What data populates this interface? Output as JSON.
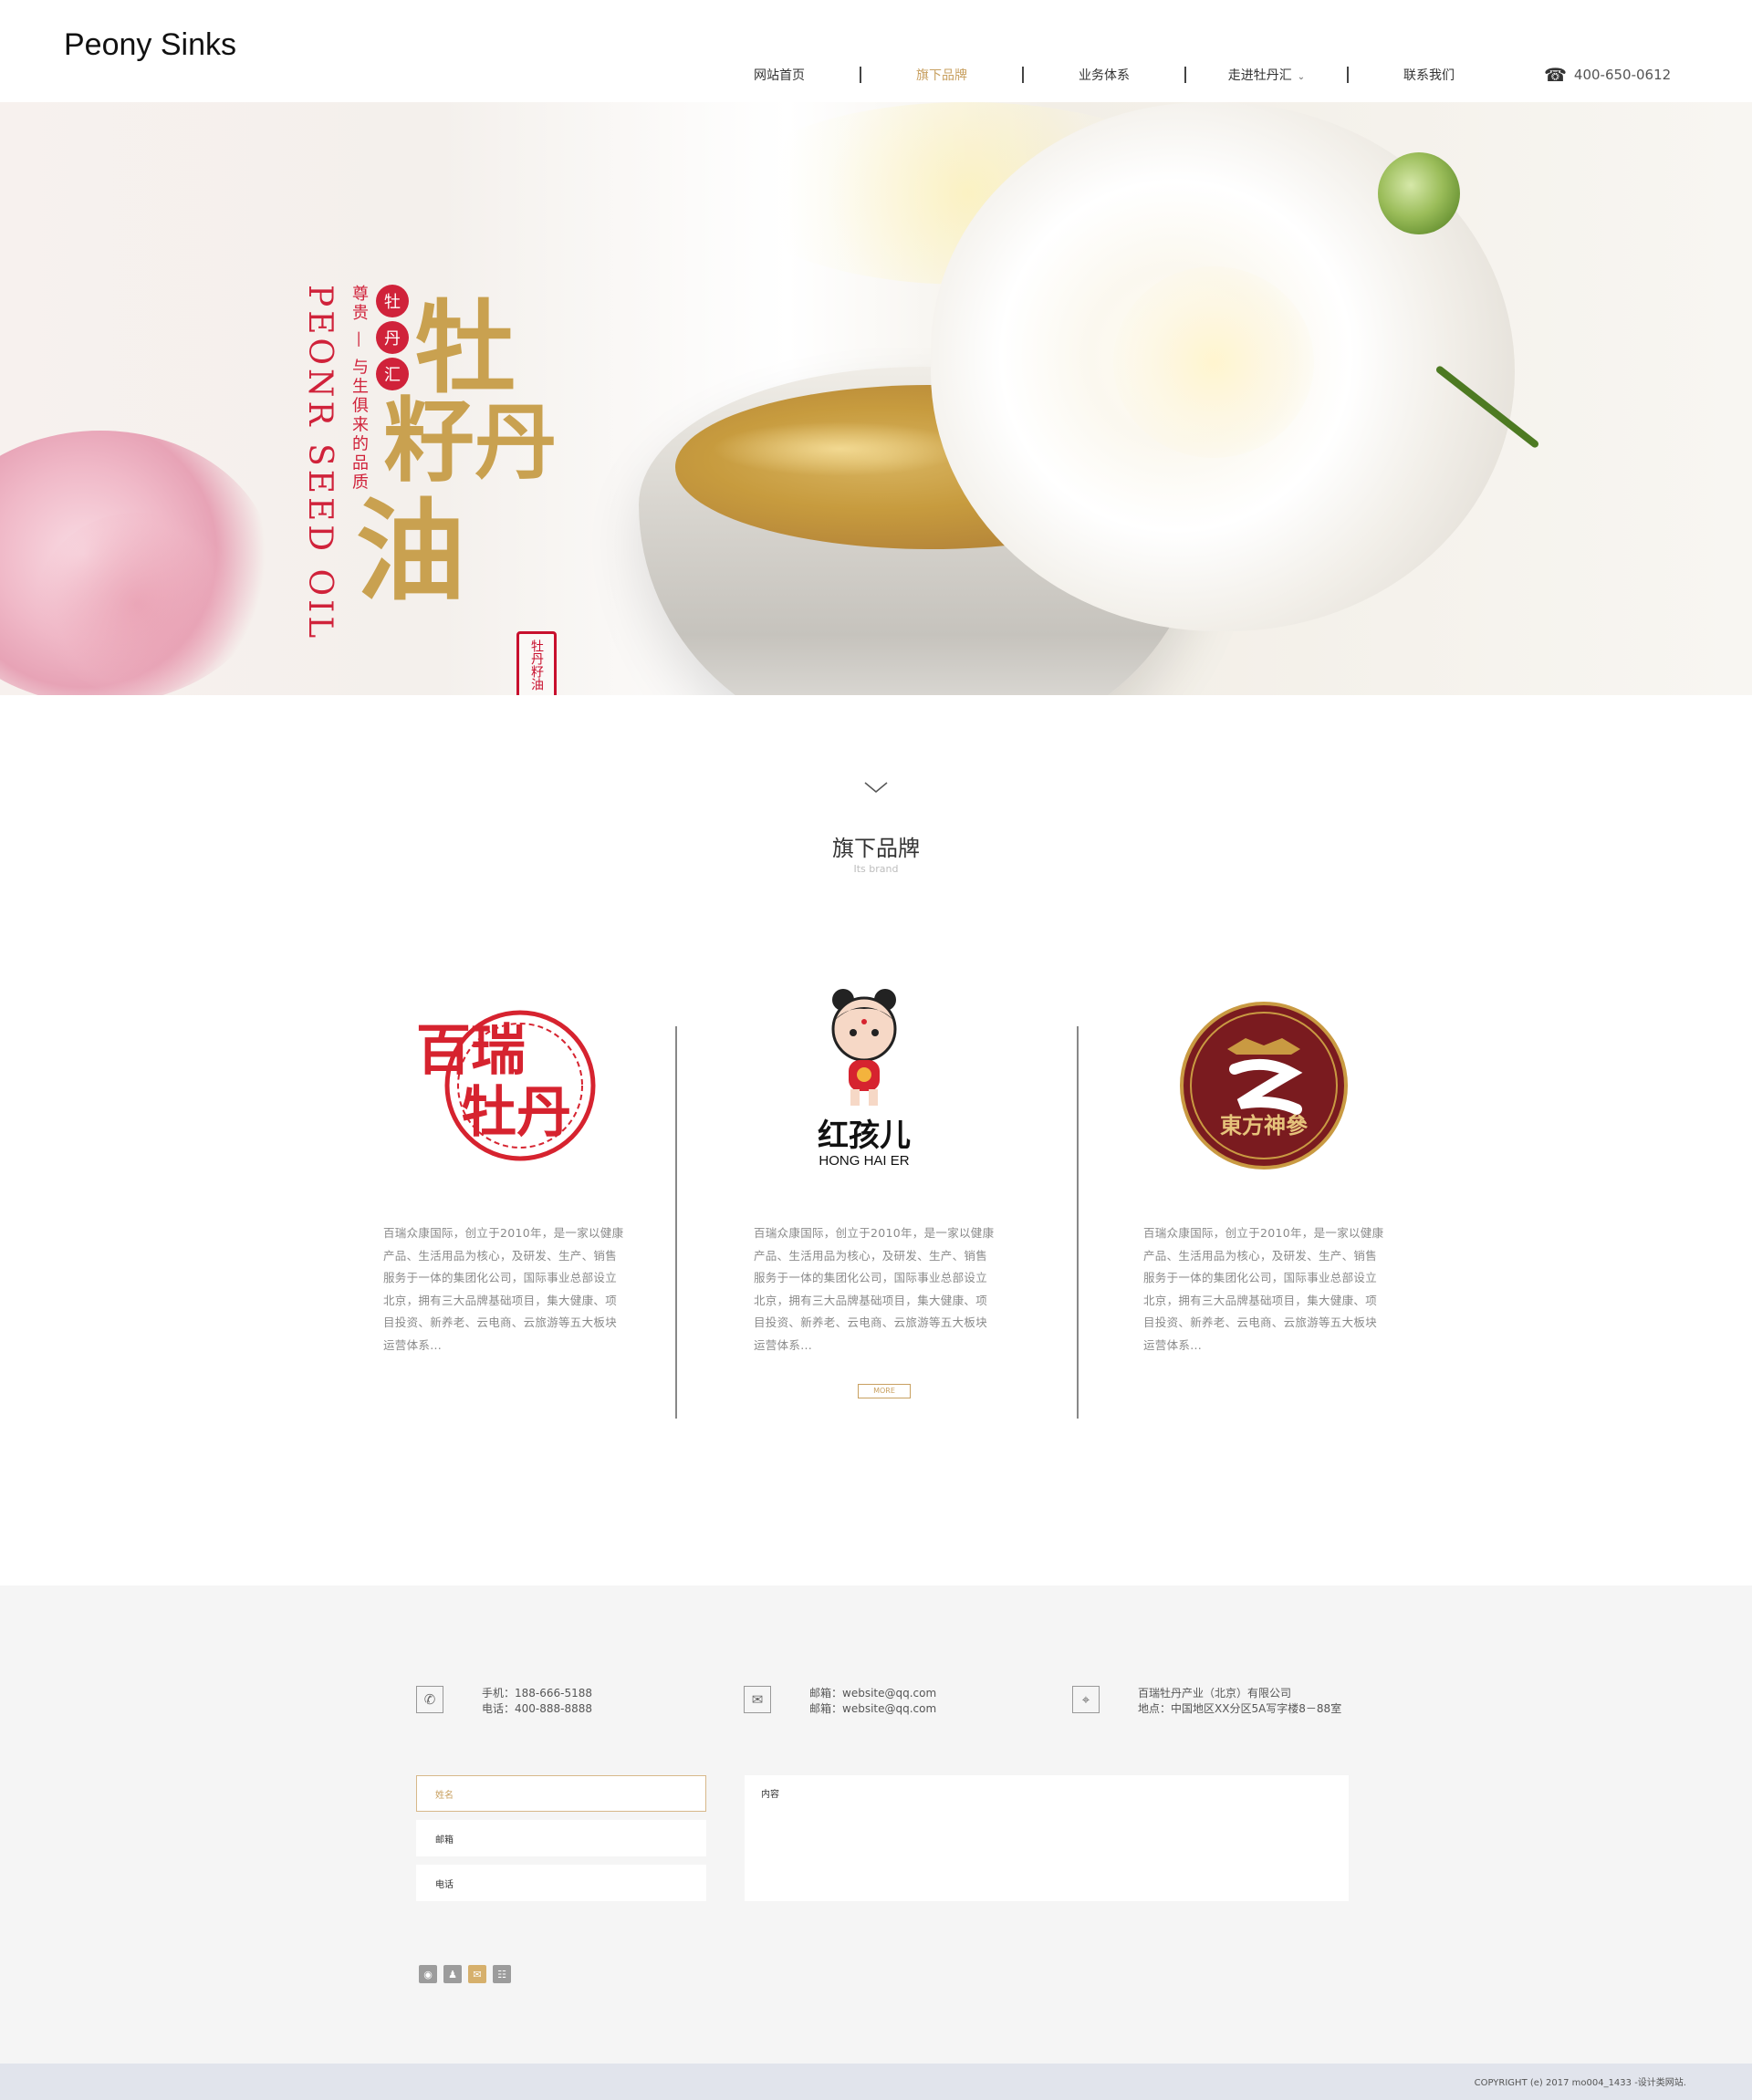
{
  "header": {
    "logo": "Peony Sinks",
    "nav": [
      {
        "label": "网站首页",
        "active": false
      },
      {
        "label": "旗下品牌",
        "active": true
      },
      {
        "label": "业务体系",
        "active": false
      },
      {
        "label": "走进牡丹汇",
        "active": false,
        "dropdown": true
      },
      {
        "label": "联系我们",
        "active": false
      }
    ],
    "phone": "400-650-0612",
    "phone_icon": "telephone-icon"
  },
  "banner": {
    "english_vertical": "PEONR SEED OIL",
    "tagline_vertical": "尊贵 — 与生俱来的品质",
    "badge_chars": [
      "牡",
      "丹",
      "汇"
    ],
    "calligraphy": [
      "牡",
      "籽",
      "丹",
      "油"
    ],
    "seal_text": "牡丹籽油"
  },
  "brands_section": {
    "title": "旗下品牌",
    "subtitle": "Its brand",
    "brands": [
      {
        "logo_text": [
          "百瑞",
          "牡丹"
        ],
        "description": "百瑞众康国际，创立于2010年，是一家以健康产品、生活用品为核心，及研发、生产、销售服务于一体的集团化公司，国际事业总部设立北京，拥有三大品牌基础项目，集大健康、项目投资、新养老、云电商、云旅游等五大板块运营体系..."
      },
      {
        "logo_text": [
          "红孩儿",
          "HONG HAI ER"
        ],
        "description": "百瑞众康国际，创立于2010年，是一家以健康产品、生活用品为核心，及研发、生产、销售服务于一体的集团化公司，国际事业总部设立北京，拥有三大品牌基础项目，集大健康、项目投资、新养老、云电商、云旅游等五大板块运营体系...",
        "more_label": "MORE"
      },
      {
        "logo_text": [
          "東方神參"
        ],
        "description": "百瑞众康国际，创立于2010年，是一家以健康产品、生活用品为核心，及研发、生产、销售服务于一体的集团化公司，国际事业总部设立北京，拥有三大品牌基础项目，集大健康、项目投资、新养老、云电商、云旅游等五大板块运营体系..."
      }
    ]
  },
  "contact": {
    "phone_block": [
      "手机：188-666-5188",
      "电话：400-888-8888"
    ],
    "email_block": [
      "邮箱：website@qq.com",
      "邮箱：website@qq.com"
    ],
    "address_block": [
      "百瑞牡丹产业（北京）有限公司",
      "地点：中国地区XX分区5A写字楼8－88室"
    ],
    "form": {
      "name_placeholder": "姓名",
      "email_placeholder": "邮箱",
      "phone_placeholder": "电话",
      "content_placeholder": "内容"
    },
    "socials": [
      {
        "icon": "weibo-icon",
        "glyph": "◉"
      },
      {
        "icon": "qq-icon",
        "glyph": "♟"
      },
      {
        "icon": "wechat-icon",
        "glyph": "✉"
      },
      {
        "icon": "renren-icon",
        "glyph": "☷"
      }
    ]
  },
  "footer": {
    "copyright": "COPYRIGHT (e) 2017 mo004_1433 -设计类网站."
  },
  "colors": {
    "accent_gold": "#c8a060",
    "brand_red": "#d0223a",
    "footer_bg": "#f5f5f5",
    "copyright_bg": "#e1e4ec"
  }
}
